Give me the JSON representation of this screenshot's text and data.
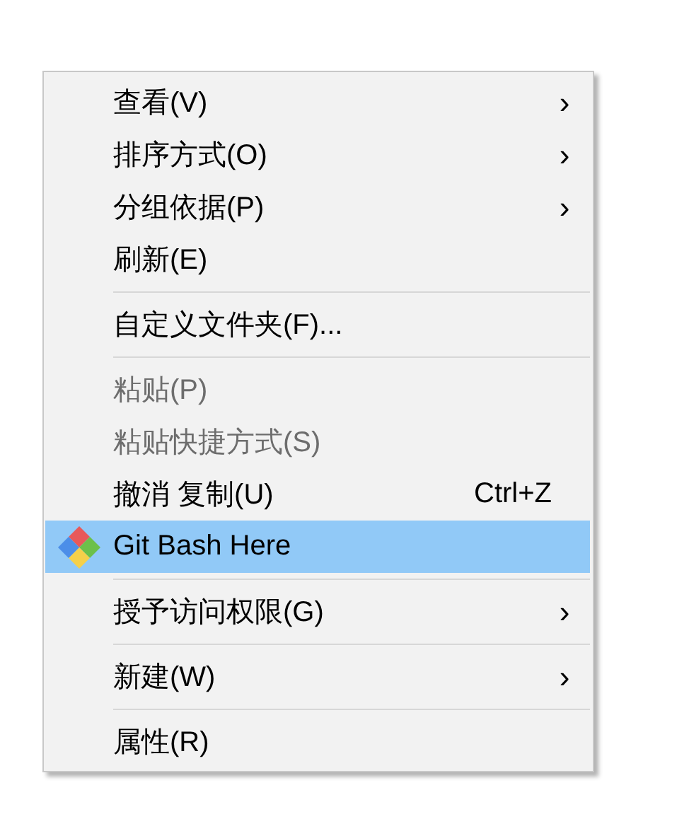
{
  "menu": {
    "items": [
      {
        "kind": "command",
        "label": "查看(V)",
        "submenu": "›",
        "disabled": false,
        "selected": false
      },
      {
        "kind": "command",
        "label": "排序方式(O)",
        "submenu": "›",
        "disabled": false,
        "selected": false
      },
      {
        "kind": "command",
        "label": "分组依据(P)",
        "submenu": "›",
        "disabled": false,
        "selected": false
      },
      {
        "kind": "command",
        "label": "刷新(E)",
        "disabled": false,
        "selected": false
      },
      {
        "kind": "separator"
      },
      {
        "kind": "command",
        "label": "自定义文件夹(F)...",
        "disabled": false,
        "selected": false
      },
      {
        "kind": "separator"
      },
      {
        "kind": "command",
        "label": "粘贴(P)",
        "disabled": true,
        "selected": false
      },
      {
        "kind": "command",
        "label": "粘贴快捷方式(S)",
        "disabled": true,
        "selected": false
      },
      {
        "kind": "command",
        "label": "撤消 复制(U)",
        "shortcut": "Ctrl+Z",
        "disabled": false,
        "selected": false
      },
      {
        "kind": "app",
        "label": "Git Bash Here",
        "disabled": false,
        "selected": true
      },
      {
        "kind": "separator"
      },
      {
        "kind": "command",
        "label": "授予访问权限(G)",
        "submenu": "›",
        "disabled": false,
        "selected": false
      },
      {
        "kind": "separator"
      },
      {
        "kind": "command",
        "label": "新建(W)",
        "submenu": "›",
        "disabled": false,
        "selected": false
      },
      {
        "kind": "separator"
      },
      {
        "kind": "command",
        "label": "属性(R)",
        "disabled": false,
        "selected": false
      }
    ]
  }
}
